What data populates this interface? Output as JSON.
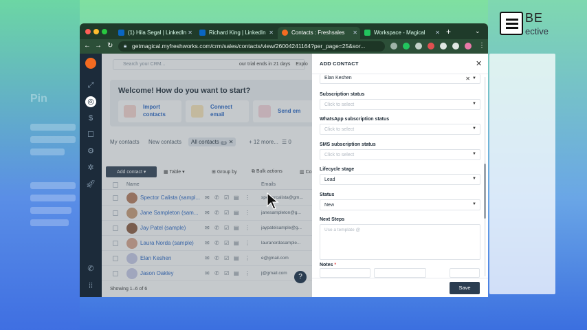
{
  "brand": {
    "logo_text": "BE",
    "logo_sub": "ective"
  },
  "colors": {
    "accent": "#2b3d51",
    "link": "#2463c4",
    "browser_frame": "#1f3b2a"
  },
  "browser": {
    "tabs": [
      {
        "label": "(1) Hila Segal | LinkedIn",
        "icon": "linkedin-icon"
      },
      {
        "label": "Richard King | LinkedIn",
        "icon": "linkedin-icon"
      },
      {
        "label": "Contacts : Freshsales",
        "icon": "freshsales-icon"
      },
      {
        "label": "Workspace - Magical",
        "icon": "magical-icon"
      }
    ],
    "url": "getmagical.myfreshworks.com/crm/sales/contacts/view/26004241164?per_page=25&sor..."
  },
  "app": {
    "search_placeholder": "Search your CRM...",
    "trial_text": "our trial ends in 21 days",
    "trial_link": "Explo",
    "welcome_title": "Welcome! How do you want to start?",
    "quick_actions": [
      {
        "label_line1": "Import",
        "label_line2": "contacts"
      },
      {
        "label_line1": "Connect",
        "label_line2": "email"
      },
      {
        "label_line1": "Send em",
        "label_line2": ""
      }
    ],
    "views": {
      "my": "My contacts",
      "new": "New contacts",
      "all": "All contacts",
      "all_count": "6",
      "more": "+ 12 more...",
      "count2": "0"
    },
    "toolbar": {
      "add": "Add contact",
      "table": "Table",
      "group_by": "Group by",
      "bulk": "Bulk actions",
      "co": "Co"
    },
    "columns": {
      "name": "Name",
      "emails": "Emails"
    },
    "rows": [
      {
        "name": "Spector Calista (sampl...",
        "email": "spectorcalista@gm..."
      },
      {
        "name": "Jane Sampleton (sam...",
        "email": "janesampleton@g..."
      },
      {
        "name": "Jay Patel (sample)",
        "email": "jaypatelsample@g..."
      },
      {
        "name": "Laura Norda (sample)",
        "email": "lauranordasample..."
      },
      {
        "name": "Elan Keshen",
        "email": "e@gmail.com"
      },
      {
        "name": "Jason Oakley",
        "email": "j@gmail.com"
      }
    ],
    "showing": "Showing 1–6 of 6",
    "help": "?"
  },
  "panel": {
    "title": "ADD CONTACT",
    "owner_value": "Elan Keshen",
    "fields": [
      {
        "label": "Subscription status",
        "value": "Click to select",
        "placeholder": true
      },
      {
        "label": "WhatsApp subscription status",
        "value": "Click to select",
        "placeholder": true
      },
      {
        "label": "SMS subscription status",
        "value": "Click to select",
        "placeholder": true
      },
      {
        "label": "Lifecycle stage",
        "value": "Lead",
        "placeholder": false
      },
      {
        "label": "Status",
        "value": "New",
        "placeholder": false
      }
    ],
    "next_steps_label": "Next Steps",
    "next_steps_placeholder": "Use a template @",
    "notes_label": "Notes",
    "save": "Save"
  }
}
